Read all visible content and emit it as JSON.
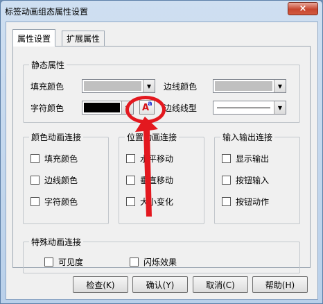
{
  "window": {
    "title": "标签动画组态属性设置",
    "close_glyph": "×"
  },
  "tabs": [
    {
      "label": "属性设置",
      "active": true
    },
    {
      "label": "扩展属性",
      "active": false
    }
  ],
  "static_group": {
    "title": "静态属性",
    "fill_color_label": "填充颜色",
    "border_color_label": "边线颜色",
    "char_color_label": "字符颜色",
    "border_style_label": "边线线型",
    "fill_color": "#c0c0c0",
    "border_color": "#c0c0c0",
    "char_color": "#000000",
    "font_icon_letter_a": "A",
    "font_icon_letter_small": "a"
  },
  "color_group": {
    "title": "颜色动画连接",
    "items": [
      "填充颜色",
      "边线颜色",
      "字符颜色"
    ]
  },
  "position_group": {
    "title": "位置动画连接",
    "items": [
      "水平移动",
      "垂直移动",
      "大小变化"
    ]
  },
  "io_group": {
    "title": "输入输出连接",
    "items": [
      "显示输出",
      "按钮输入",
      "按钮动作"
    ]
  },
  "special_group": {
    "title": "特殊动画连接",
    "items": [
      "可见度",
      "闪烁效果"
    ]
  },
  "buttons": {
    "check": "检查(K)",
    "ok": "确认(Y)",
    "cancel": "取消(C)",
    "help": "帮助(H)"
  },
  "colors": {
    "annotation_red": "#e3181f"
  }
}
